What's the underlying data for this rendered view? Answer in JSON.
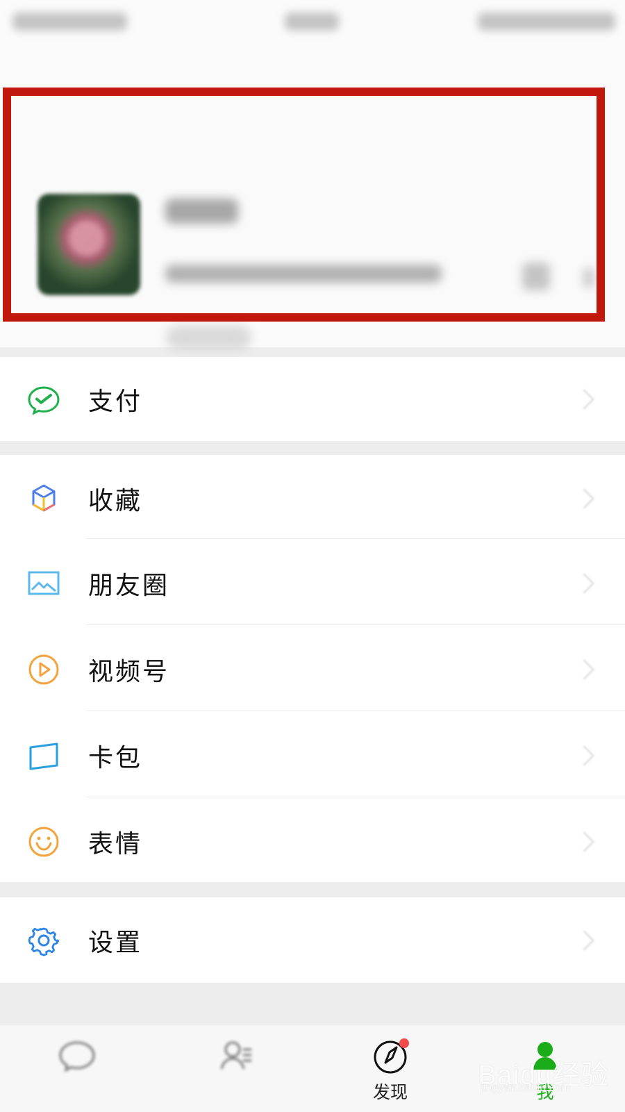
{
  "menu": {
    "pay": {
      "label": "支付",
      "icon": "wechat-pay-icon"
    },
    "favorites": {
      "label": "收藏",
      "icon": "favorites-cube-icon"
    },
    "moments": {
      "label": "朋友圈",
      "icon": "photo-icon"
    },
    "channels": {
      "label": "视频号",
      "icon": "play-circle-icon"
    },
    "card_package": {
      "label": "卡包",
      "icon": "card-icon"
    },
    "stickers": {
      "label": "表情",
      "icon": "smile-icon"
    },
    "settings": {
      "label": "设置",
      "icon": "gear-icon"
    }
  },
  "tabbar": {
    "discover": {
      "label": "发现"
    },
    "me": {
      "label": "我"
    }
  },
  "watermark": {
    "main": "Baidu经验",
    "sub": "jingyan.baidu.com"
  },
  "colors": {
    "highlight": "#c1170d",
    "wechat_green": "#1aad19"
  }
}
